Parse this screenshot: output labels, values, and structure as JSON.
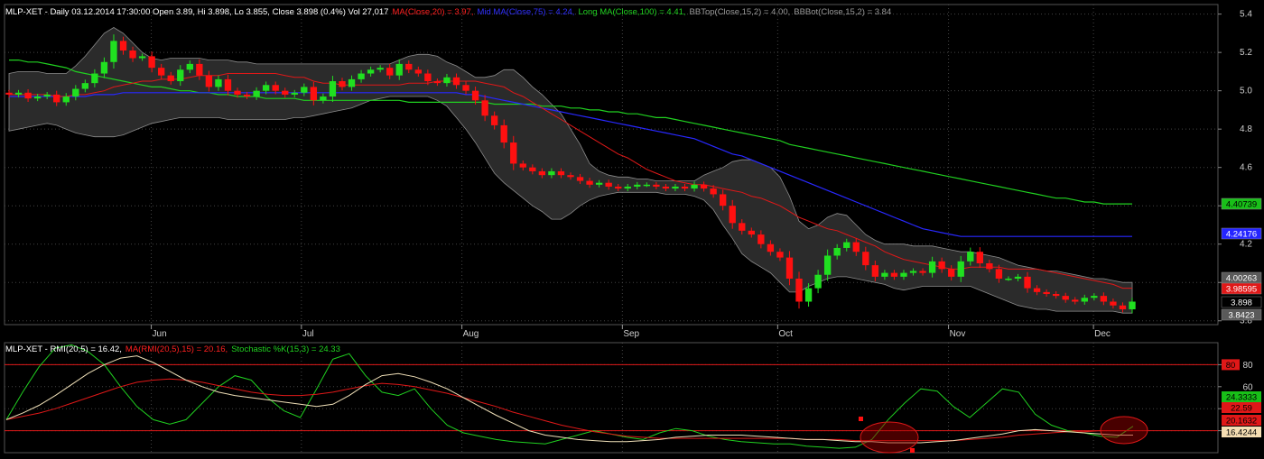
{
  "upper_panel": {
    "header": [
      {
        "text": "MLP-XET - Daily 03.12.2014 17:30:00 Open 3.89, Hi 3.898, Lo 3.855, Close 3.898 (0.4%) Vol 27,017",
        "color": "#ffffff"
      },
      {
        "text": "MA(Close,20) = 3.97,",
        "color": "#ff2020"
      },
      {
        "text": "Mid MA(Close,75) = 4.24,",
        "color": "#3030ff"
      },
      {
        "text": "Long MA(Close,100) = 4.41,",
        "color": "#20d020"
      },
      {
        "text": "BBTop(Close,15,2) = 4.00,",
        "color": "#9a9a9a"
      },
      {
        "text": "BBBot(Close,15,2) = 3.84",
        "color": "#9a9a9a"
      }
    ],
    "y_ticks": [
      "5.4",
      "5.2",
      "5.0",
      "4.8",
      "4.6",
      "4.4",
      "4.2",
      "4.0",
      "3.8"
    ],
    "value_tags": [
      {
        "label": "4.40739",
        "bg": "#18c018",
        "fg": "#000000"
      },
      {
        "label": "4.24176",
        "bg": "#2525ff",
        "fg": "#ffffff"
      },
      {
        "label": "4.00263",
        "bg": "#5a5a5a",
        "fg": "#ffffff"
      },
      {
        "label": "3.98595",
        "bg": "#e01818",
        "fg": "#ffffff"
      },
      {
        "label": "3.898",
        "bg": "#000000",
        "fg": "#ffffff"
      },
      {
        "label": "3.8423",
        "bg": "#5a5a5a",
        "fg": "#ffffff"
      }
    ]
  },
  "x_axis_labels": [
    "Jun",
    "Jul",
    "Aug",
    "Sep",
    "Oct",
    "Nov",
    "Dec"
  ],
  "lower_panel": {
    "header": [
      {
        "text": "MLP-XET - RMI(20,5) = 16.42,",
        "color": "#ffffff"
      },
      {
        "text": "MA(RMI(20,5),15) = 20.16,",
        "color": "#ff2020"
      },
      {
        "text": "Stochastic %K(15,3) = 24.33",
        "color": "#20d020"
      }
    ],
    "y_ticks": [
      "80",
      "60",
      "40",
      "20"
    ],
    "value_tags": [
      {
        "label": "80",
        "bg": "#e01818",
        "fg": "#000000"
      },
      {
        "label": "24.3333",
        "bg": "#18c018",
        "fg": "#000000"
      },
      {
        "label": "22.59",
        "bg": "#e01818",
        "fg": "#000000"
      },
      {
        "label": "20.1632",
        "bg": "#e01818",
        "fg": "#000000"
      },
      {
        "label": "16.4244",
        "bg": "#f5deb3",
        "fg": "#000000"
      }
    ]
  },
  "chart_data": [
    {
      "type": "candlestick",
      "ylim": [
        3.78,
        5.45
      ],
      "x_range": [
        "2014-05-05",
        "2014-12-09"
      ],
      "month_ticks": [
        "2014-06-02",
        "2014-07-01",
        "2014-08-01",
        "2014-09-01",
        "2014-10-01",
        "2014-11-03",
        "2014-12-01"
      ],
      "grid": true,
      "colors": {
        "up": "#20e020",
        "down": "#ff1010",
        "ma20": "#ff2020",
        "ma75": "#3030ff",
        "ma100": "#20d020",
        "bb": "#9a9a9a"
      },
      "close": [
        4.98,
        4.99,
        4.96,
        4.97,
        4.98,
        4.94,
        4.97,
        5.01,
        5.04,
        5.09,
        5.15,
        5.26,
        5.21,
        5.17,
        5.18,
        5.12,
        5.08,
        5.05,
        5.11,
        5.14,
        5.08,
        5.02,
        5.06,
        5.0,
        4.98,
        4.97,
        5.0,
        5.03,
        5.0,
        4.98,
        4.99,
        5.02,
        4.95,
        4.97,
        5.05,
        5.02,
        5.06,
        5.09,
        5.11,
        5.12,
        5.08,
        5.14,
        5.11,
        5.09,
        5.05,
        5.04,
        5.07,
        5.03,
        5.0,
        4.95,
        4.87,
        4.82,
        4.73,
        4.62,
        4.6,
        4.58,
        4.56,
        4.58,
        4.56,
        4.55,
        4.53,
        4.51,
        4.52,
        4.5,
        4.49,
        4.5,
        4.51,
        4.51,
        4.5,
        4.49,
        4.5,
        4.49,
        4.51,
        4.49,
        4.46,
        4.4,
        4.31,
        4.27,
        4.25,
        4.2,
        4.16,
        4.13,
        4.02,
        3.9,
        3.97,
        4.04,
        4.14,
        4.18,
        4.21,
        4.16,
        4.09,
        4.03,
        4.05,
        4.03,
        4.05,
        4.06,
        4.05,
        4.11,
        4.07,
        4.03,
        4.11,
        4.16,
        4.1,
        4.07,
        4.02,
        4.02,
        4.03,
        3.97,
        3.95,
        3.94,
        3.93,
        3.91,
        3.9,
        3.92,
        3.93,
        3.9,
        3.88,
        3.86,
        3.9
      ],
      "ma20": [
        4.98,
        4.98,
        4.98,
        4.98,
        4.98,
        4.97,
        4.97,
        4.98,
        4.98,
        4.99,
        5.0,
        5.02,
        5.03,
        5.04,
        5.05,
        5.05,
        5.06,
        5.06,
        5.06,
        5.07,
        5.08,
        5.08,
        5.08,
        5.09,
        5.09,
        5.09,
        5.09,
        5.09,
        5.09,
        5.08,
        5.07,
        5.07,
        5.05,
        5.04,
        5.04,
        5.03,
        5.03,
        5.03,
        5.03,
        5.03,
        5.03,
        5.03,
        5.04,
        5.04,
        5.04,
        5.05,
        5.05,
        5.05,
        5.05,
        5.05,
        5.04,
        5.03,
        5.02,
        4.99,
        4.97,
        4.94,
        4.91,
        4.88,
        4.85,
        4.82,
        4.79,
        4.76,
        4.73,
        4.7,
        4.67,
        4.65,
        4.62,
        4.59,
        4.57,
        4.55,
        4.53,
        4.52,
        4.51,
        4.51,
        4.5,
        4.49,
        4.48,
        4.47,
        4.45,
        4.44,
        4.42,
        4.4,
        4.37,
        4.34,
        4.32,
        4.3,
        4.28,
        4.27,
        4.25,
        4.23,
        4.21,
        4.19,
        4.16,
        4.14,
        4.12,
        4.11,
        4.1,
        4.09,
        4.08,
        4.07,
        4.07,
        4.08,
        4.08,
        4.08,
        4.08,
        4.07,
        4.07,
        4.07,
        4.07,
        4.06,
        4.05,
        4.04,
        4.03,
        4.02,
        4.01,
        4.0,
        3.99,
        3.97,
        3.97
      ],
      "ma75": [
        4.97,
        4.97,
        4.97,
        4.97,
        4.97,
        4.97,
        4.97,
        4.97,
        4.97,
        4.98,
        4.98,
        4.98,
        4.99,
        4.99,
        4.99,
        4.99,
        4.99,
        4.99,
        4.99,
        4.99,
        4.99,
        4.99,
        4.99,
        4.99,
        4.99,
        4.99,
        4.99,
        4.99,
        4.99,
        4.99,
        4.99,
        4.99,
        4.99,
        4.99,
        4.99,
        4.99,
        4.99,
        4.99,
        4.99,
        4.99,
        4.99,
        4.99,
        4.99,
        4.99,
        4.99,
        4.99,
        4.99,
        4.99,
        4.98,
        4.98,
        4.97,
        4.96,
        4.95,
        4.94,
        4.93,
        4.92,
        4.91,
        4.9,
        4.89,
        4.88,
        4.87,
        4.86,
        4.85,
        4.84,
        4.83,
        4.82,
        4.81,
        4.8,
        4.79,
        4.78,
        4.77,
        4.76,
        4.75,
        4.73,
        4.71,
        4.69,
        4.67,
        4.66,
        4.64,
        4.62,
        4.6,
        4.58,
        4.56,
        4.54,
        4.52,
        4.5,
        4.48,
        4.46,
        4.44,
        4.42,
        4.4,
        4.38,
        4.36,
        4.34,
        4.32,
        4.3,
        4.28,
        4.27,
        4.26,
        4.25,
        4.24,
        4.24,
        4.24,
        4.24,
        4.24,
        4.24,
        4.24,
        4.24,
        4.24,
        4.24,
        4.24,
        4.24,
        4.24,
        4.24,
        4.24,
        4.24,
        4.24,
        4.24,
        4.24
      ],
      "ma100": [
        5.16,
        5.16,
        5.15,
        5.15,
        5.14,
        5.13,
        5.12,
        5.1,
        5.09,
        5.08,
        5.07,
        5.06,
        5.05,
        5.04,
        5.03,
        5.02,
        5.02,
        5.01,
        5.0,
        5.0,
        4.99,
        4.99,
        4.98,
        4.98,
        4.97,
        4.97,
        4.97,
        4.96,
        4.96,
        4.96,
        4.96,
        4.95,
        4.95,
        4.95,
        4.95,
        4.95,
        4.95,
        4.95,
        4.95,
        4.95,
        4.95,
        4.95,
        4.94,
        4.94,
        4.94,
        4.94,
        4.94,
        4.94,
        4.94,
        4.94,
        4.94,
        4.93,
        4.93,
        4.93,
        4.93,
        4.93,
        4.92,
        4.92,
        4.92,
        4.91,
        4.91,
        4.9,
        4.9,
        4.89,
        4.89,
        4.88,
        4.88,
        4.87,
        4.86,
        4.86,
        4.85,
        4.84,
        4.83,
        4.82,
        4.81,
        4.8,
        4.79,
        4.78,
        4.77,
        4.76,
        4.75,
        4.74,
        4.72,
        4.71,
        4.7,
        4.69,
        4.68,
        4.67,
        4.66,
        4.65,
        4.64,
        4.63,
        4.62,
        4.61,
        4.6,
        4.59,
        4.58,
        4.57,
        4.56,
        4.55,
        4.54,
        4.53,
        4.52,
        4.51,
        4.5,
        4.49,
        4.48,
        4.47,
        4.46,
        4.45,
        4.44,
        4.44,
        4.43,
        4.42,
        4.42,
        4.41,
        4.41,
        4.41,
        4.41
      ],
      "bb_top": [
        5.09,
        5.1,
        5.1,
        5.1,
        5.09,
        5.09,
        5.09,
        5.13,
        5.18,
        5.24,
        5.3,
        5.33,
        5.3,
        5.25,
        5.2,
        5.17,
        5.16,
        5.17,
        5.17,
        5.17,
        5.17,
        5.16,
        5.16,
        5.16,
        5.15,
        5.15,
        5.14,
        5.14,
        5.14,
        5.14,
        5.14,
        5.14,
        5.14,
        5.14,
        5.14,
        5.14,
        5.14,
        5.14,
        5.14,
        5.14,
        5.14,
        5.16,
        5.18,
        5.19,
        5.19,
        5.18,
        5.15,
        5.13,
        5.1,
        5.07,
        5.07,
        5.08,
        5.11,
        5.11,
        5.07,
        5.02,
        4.98,
        4.93,
        4.88,
        4.8,
        4.72,
        4.62,
        4.58,
        4.56,
        4.55,
        4.55,
        4.54,
        4.54,
        4.53,
        4.53,
        4.53,
        4.53,
        4.53,
        4.56,
        4.58,
        4.6,
        4.63,
        4.64,
        4.64,
        4.62,
        4.6,
        4.55,
        4.45,
        4.32,
        4.28,
        4.3,
        4.34,
        4.36,
        4.35,
        4.3,
        4.25,
        4.22,
        4.2,
        4.2,
        4.2,
        4.19,
        4.19,
        4.19,
        4.18,
        4.17,
        4.16,
        4.16,
        4.15,
        4.14,
        4.13,
        4.11,
        4.09,
        4.08,
        4.07,
        4.06,
        4.06,
        4.05,
        4.04,
        4.03,
        4.02,
        4.02,
        4.01,
        4.0,
        4.0
      ],
      "bb_bot": [
        4.79,
        4.8,
        4.81,
        4.82,
        4.83,
        4.82,
        4.8,
        4.78,
        4.77,
        4.76,
        4.76,
        4.76,
        4.77,
        4.79,
        4.81,
        4.83,
        4.84,
        4.85,
        4.86,
        4.86,
        4.86,
        4.86,
        4.86,
        4.85,
        4.85,
        4.85,
        4.85,
        4.85,
        4.85,
        4.85,
        4.86,
        4.86,
        4.87,
        4.88,
        4.89,
        4.9,
        4.91,
        4.93,
        4.95,
        4.96,
        4.97,
        4.97,
        4.97,
        4.97,
        4.97,
        4.95,
        4.92,
        4.86,
        4.8,
        4.73,
        4.65,
        4.57,
        4.52,
        4.48,
        4.44,
        4.4,
        4.37,
        4.33,
        4.33,
        4.36,
        4.4,
        4.43,
        4.45,
        4.46,
        4.47,
        4.47,
        4.47,
        4.47,
        4.47,
        4.46,
        4.46,
        4.46,
        4.45,
        4.43,
        4.38,
        4.3,
        4.23,
        4.15,
        4.11,
        4.08,
        4.05,
        4.0,
        3.95,
        3.95,
        3.98,
        4.0,
        4.02,
        4.03,
        4.03,
        4.02,
        4.01,
        4.0,
        3.99,
        3.97,
        3.96,
        3.97,
        3.98,
        3.98,
        3.98,
        3.98,
        3.98,
        3.98,
        3.96,
        3.94,
        3.92,
        3.9,
        3.88,
        3.87,
        3.86,
        3.86,
        3.85,
        3.85,
        3.85,
        3.85,
        3.85,
        3.85,
        3.85,
        3.84,
        3.84
      ],
      "last_close": 3.898
    },
    {
      "type": "line",
      "ylim": [
        0,
        100
      ],
      "grid": true,
      "hlines": [
        80,
        20
      ],
      "series": [
        {
          "name": "RMI(20,5)",
          "color": "#ffffff",
          "values": [
            30,
            36,
            43,
            52,
            62,
            72,
            80,
            86,
            88,
            82,
            74,
            66,
            60,
            55,
            52,
            50,
            48,
            46,
            44,
            42,
            44,
            52,
            62,
            70,
            72,
            69,
            64,
            58,
            50,
            42,
            34,
            27,
            20,
            16,
            14,
            12,
            11,
            10,
            10,
            11,
            12,
            14,
            15,
            16,
            16,
            16,
            15,
            14,
            13,
            12,
            12,
            11,
            10,
            10,
            9,
            9,
            9,
            10,
            11,
            13,
            15,
            17,
            20,
            21,
            20,
            19,
            18,
            17,
            16,
            16
          ]
        },
        {
          "name": "MA(RMI(20,5),15)",
          "color": "#ff2020",
          "values": [
            30,
            33,
            36,
            40,
            45,
            50,
            55,
            60,
            64,
            66,
            67,
            66,
            64,
            61,
            58,
            55,
            53,
            52,
            52,
            53,
            55,
            58,
            61,
            63,
            62,
            60,
            57,
            54,
            50,
            46,
            42,
            37,
            33,
            29,
            25,
            22,
            19,
            17,
            15,
            14,
            13,
            13,
            13,
            13,
            13,
            13,
            13,
            13,
            13,
            12,
            12,
            12,
            11,
            11,
            11,
            11,
            11,
            11,
            11,
            12,
            13,
            14,
            16,
            17,
            18,
            19,
            19,
            20,
            20,
            20
          ]
        },
        {
          "name": "Stochastic %K(15,3)",
          "color": "#20d020",
          "values": [
            30,
            55,
            78,
            95,
            98,
            92,
            80,
            60,
            42,
            30,
            26,
            30,
            45,
            60,
            70,
            66,
            50,
            38,
            32,
            58,
            85,
            90,
            70,
            55,
            52,
            58,
            40,
            25,
            18,
            15,
            12,
            10,
            9,
            8,
            12,
            16,
            20,
            17,
            14,
            12,
            18,
            22,
            20,
            15,
            12,
            10,
            9,
            8,
            8,
            6,
            5,
            4,
            5,
            12,
            30,
            45,
            58,
            56,
            42,
            32,
            45,
            58,
            55,
            35,
            25,
            20,
            18,
            15,
            14,
            24
          ]
        }
      ]
    }
  ]
}
